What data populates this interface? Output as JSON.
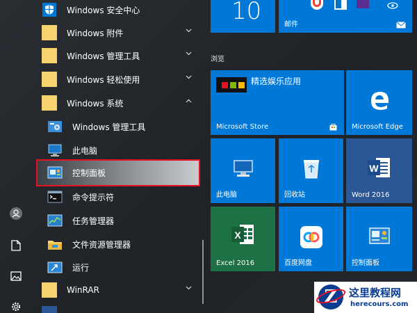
{
  "colors": {
    "tile_blue": "#0078d7",
    "folder": "#f6d36c",
    "highlight_border": "#e81123",
    "excel_green": "#1e7145"
  },
  "applist": {
    "items": [
      {
        "label": "Windows 安全中心",
        "icon": "shield-icon",
        "expandable": false
      },
      {
        "label": "Windows 附件",
        "icon": "folder-icon",
        "expandable": true,
        "expanded": false
      },
      {
        "label": "Windows 管理工具",
        "icon": "folder-icon",
        "expandable": true,
        "expanded": false
      },
      {
        "label": "Windows 轻松使用",
        "icon": "folder-icon",
        "expandable": true,
        "expanded": false
      },
      {
        "label": "Windows 系统",
        "icon": "folder-icon",
        "expandable": true,
        "expanded": true
      }
    ],
    "sub_items": [
      {
        "label": "Windows 管理工具",
        "icon": "admin-tools-icon"
      },
      {
        "label": "此电脑",
        "icon": "computer-icon"
      },
      {
        "label": "控制面板",
        "icon": "control-panel-icon",
        "selected": true
      },
      {
        "label": "命令提示符",
        "icon": "cmd-icon"
      },
      {
        "label": "任务管理器",
        "icon": "task-manager-icon"
      },
      {
        "label": "文件资源管理器",
        "icon": "file-explorer-icon"
      },
      {
        "label": "运行",
        "icon": "run-icon"
      }
    ],
    "after_items": [
      {
        "label": "WinRAR",
        "icon": "folder-icon",
        "expandable": true
      }
    ]
  },
  "tiles": {
    "calendar_number": "10",
    "mail_label": "邮件",
    "section_title": "浏览",
    "store_top": "精选娱乐应用",
    "store_label": "Microsoft Store",
    "edge_label": "Microsoft Edge",
    "pc_label": "此电脑",
    "recycle_label": "回收站",
    "word_label": "Word 2016",
    "excel_label": "Excel 2016",
    "baidu_label": "百度网盘",
    "cp_label": "控制面板"
  },
  "watermark": {
    "title": "这里教程网",
    "url": "herecours.com",
    "logo_letter": "Z"
  }
}
